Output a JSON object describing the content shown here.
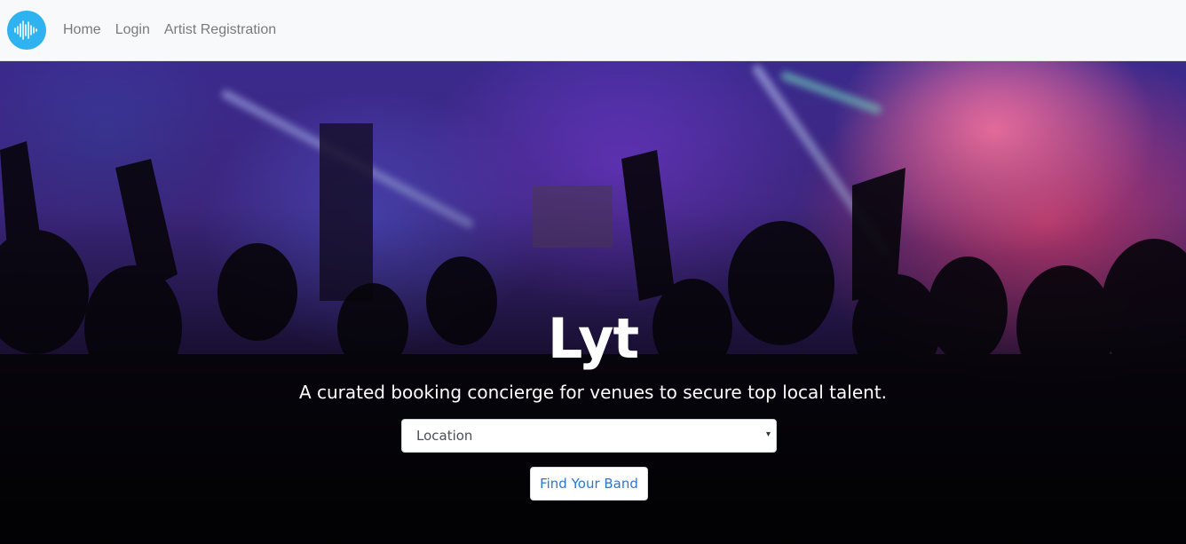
{
  "nav": {
    "logo": "waveform-icon",
    "links": [
      {
        "label": "Home"
      },
      {
        "label": "Login"
      },
      {
        "label": "Artist Registration"
      }
    ]
  },
  "hero": {
    "title": "Lyt",
    "subtitle": "A curated booking concierge for venues to secure top local talent.",
    "location_select": {
      "selected": "Location"
    },
    "cta_label": "Find Your Band"
  },
  "colors": {
    "logo_bg": "#2fb2f0",
    "navbar_bg": "#f8f9fa",
    "link_color": "#7a7a7a",
    "cta_text": "#2a76d2"
  }
}
